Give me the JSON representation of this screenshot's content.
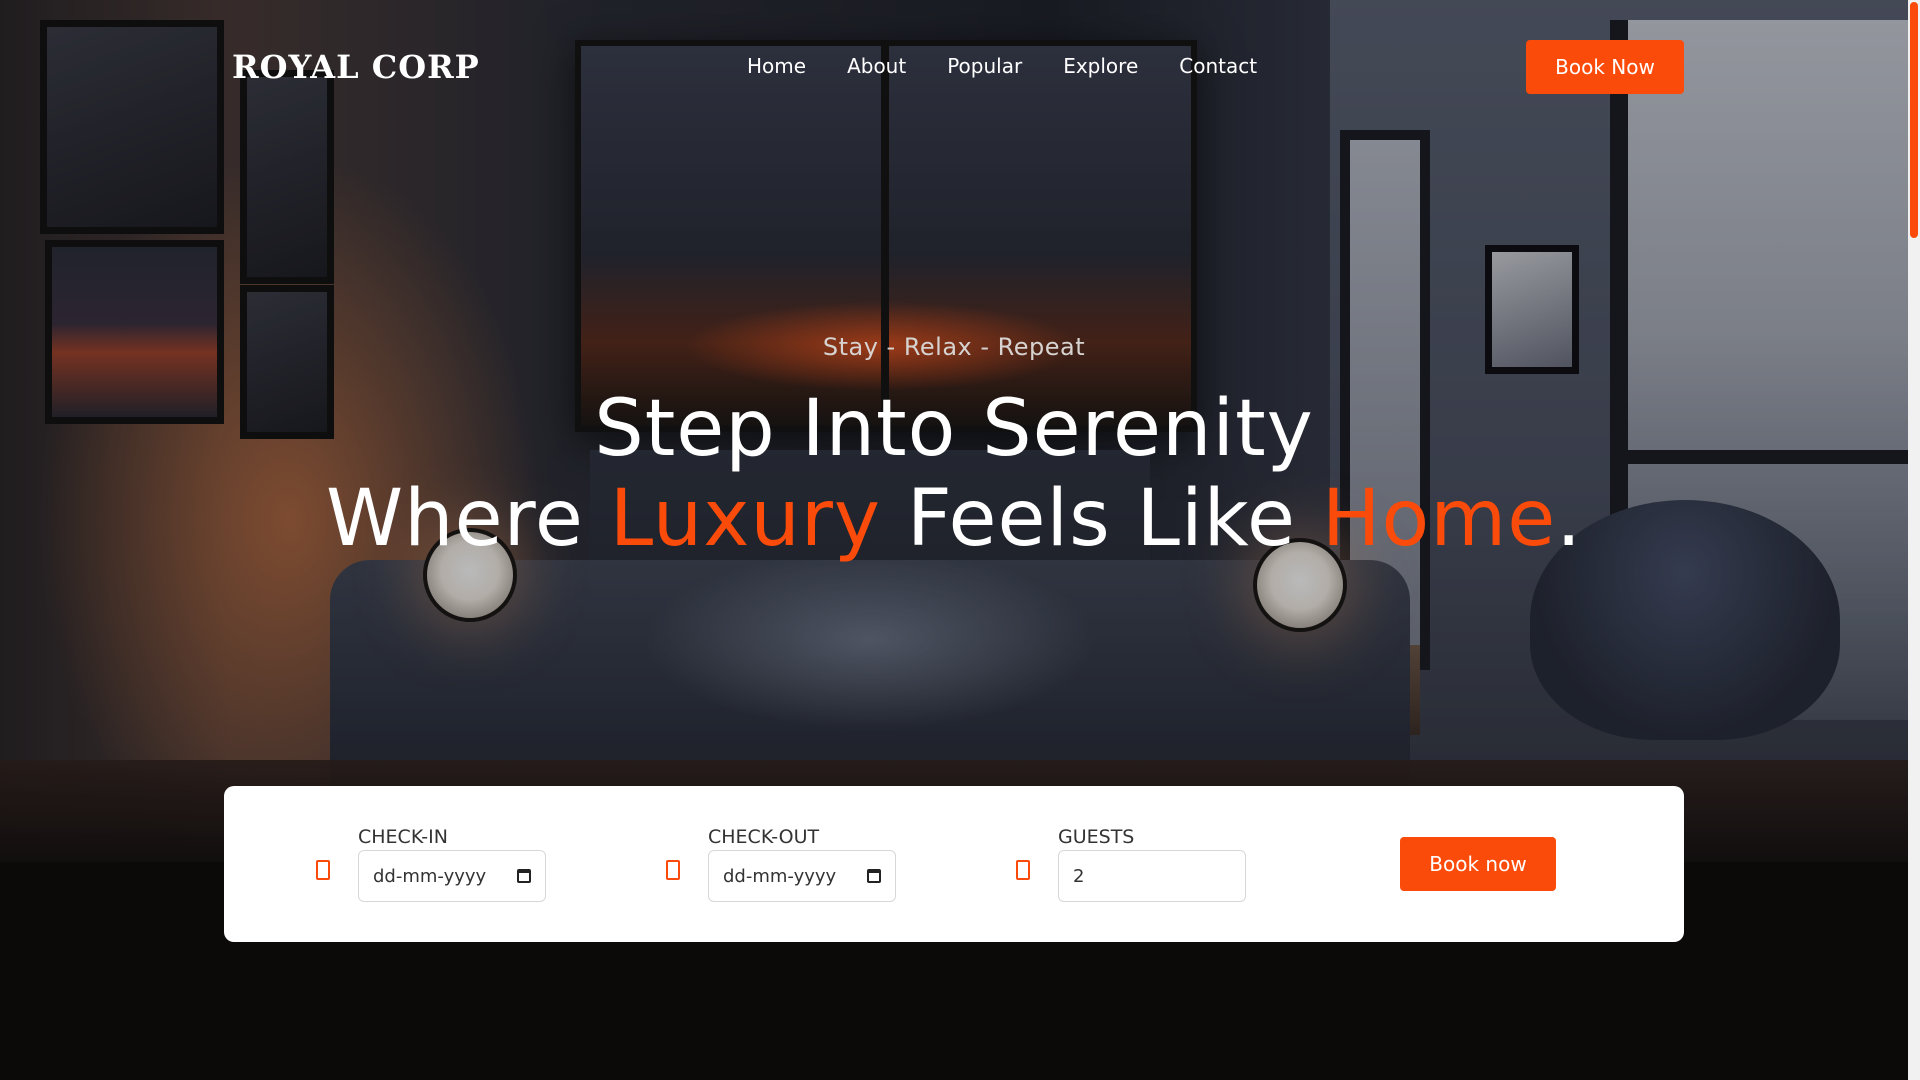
{
  "brand": "ROYAL CORP",
  "nav": {
    "items": [
      "Home",
      "About",
      "Popular",
      "Explore",
      "Contact"
    ],
    "cta_label": "Book Now"
  },
  "hero": {
    "tagline": "Stay - Relax - Repeat",
    "headline_line1": "Step Into Serenity",
    "headline_line2": {
      "part1": "Where ",
      "accent1": "Luxury",
      "part2": " Feels Like ",
      "accent2": "Home",
      "part3": "."
    }
  },
  "booking": {
    "check_in": {
      "label": "CHECK-IN",
      "placeholder": "dd-mm-yyyy",
      "icon": "calendar-icon"
    },
    "check_out": {
      "label": "CHECK-OUT",
      "placeholder": "dd-mm-yyyy",
      "icon": "calendar-icon"
    },
    "guests": {
      "label": "GUESTS",
      "value": "2",
      "icon": "user-icon"
    },
    "submit_label": "Book now"
  },
  "colors": {
    "accent": "#fb4b0a",
    "page_background": "#0c0a09",
    "card_background": "#ffffff"
  }
}
